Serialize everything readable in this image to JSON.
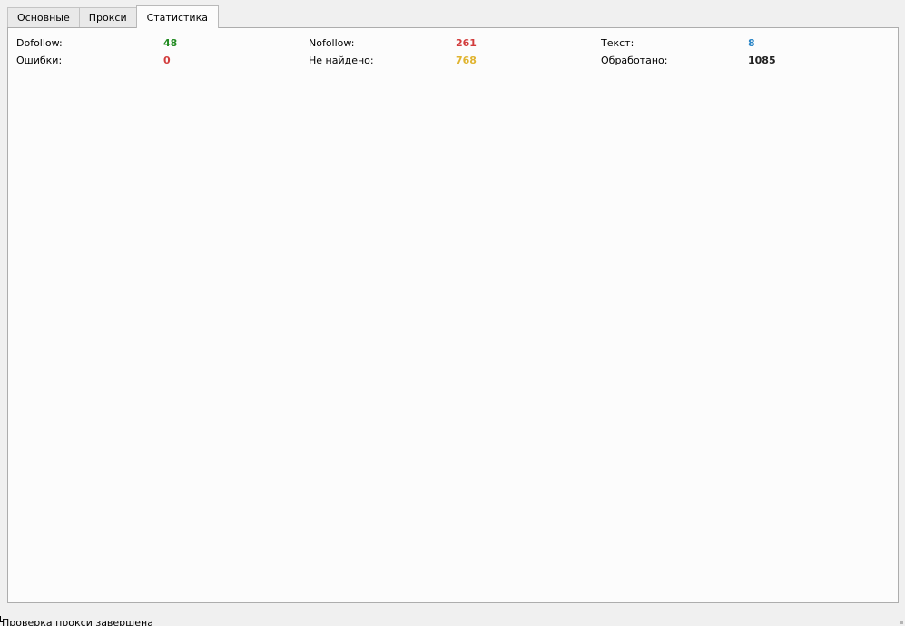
{
  "tabs": [
    {
      "label": "Основные",
      "active": false
    },
    {
      "label": "Прокси",
      "active": false
    },
    {
      "label": "Статистика",
      "active": true
    }
  ],
  "stats": {
    "row1": {
      "dofollow": {
        "label": "Dofollow:",
        "value": "48",
        "color": "#228b22"
      },
      "nofollow": {
        "label": "Nofollow:",
        "value": "261",
        "color": "#d23c3c"
      },
      "text": {
        "label": "Текст:",
        "value": "8",
        "color": "#2a85c6"
      }
    },
    "row2": {
      "errors": {
        "label": "Ошибки:",
        "value": "0",
        "color": "#d23c3c"
      },
      "not_found": {
        "label": "Не найдено:",
        "value": "768",
        "color": "#e0b430"
      },
      "processed": {
        "label": "Обработано:",
        "value": "1085",
        "color": "#222222"
      }
    }
  },
  "status": {
    "text": "Проверка прокси завершена"
  }
}
